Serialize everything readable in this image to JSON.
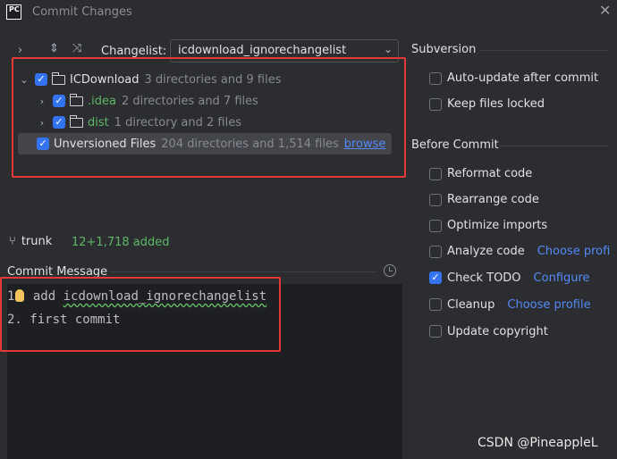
{
  "window": {
    "app_icon_label": "PC",
    "title": "Commit Changes",
    "close_icon": "close-icon"
  },
  "toolbar": {
    "changelist_label": "Changelist:",
    "changelist_value": "icdownload_ignorechangelist"
  },
  "tree": [
    {
      "name": "ICDownload",
      "info": "3 directories and 9 files",
      "checked": true,
      "expanded": true
    },
    {
      "name": ".idea",
      "info": "2 directories and 7 files",
      "checked": true,
      "expanded": false
    },
    {
      "name": "dist",
      "info": "1 directory and 2 files",
      "checked": true,
      "expanded": false
    },
    {
      "name": "Unversioned Files",
      "info": "204 directories and 1,514 files",
      "link": "browse",
      "checked": true
    }
  ],
  "branch": {
    "name": "trunk",
    "stats": "12+1,718 added"
  },
  "commit_message": {
    "label": "Commit Message",
    "lines": [
      {
        "num": "1.",
        "text": "add icdownload_ignorechangelist"
      },
      {
        "num": "2.",
        "text": "first commit"
      }
    ]
  },
  "subversion": {
    "title": "Subversion",
    "options": [
      {
        "label": "Auto-update after commit",
        "checked": false
      },
      {
        "label": "Keep files locked",
        "checked": false
      }
    ]
  },
  "before_commit": {
    "title": "Before Commit",
    "options": [
      {
        "label": "Reformat code",
        "checked": false
      },
      {
        "label": "Rearrange code",
        "checked": false
      },
      {
        "label": "Optimize imports",
        "checked": false
      },
      {
        "label": "Analyze code",
        "checked": false,
        "link": "Choose profi"
      },
      {
        "label": "Check TODO",
        "checked": true,
        "link": "Configure"
      },
      {
        "label": "Cleanup",
        "checked": false,
        "link": "Choose profile"
      },
      {
        "label": "Update copyright",
        "checked": false
      }
    ]
  },
  "watermark": "CSDN @PineappleL",
  "colors": {
    "accent": "#3574f0",
    "link": "#548af7",
    "added_green": "#5fb865",
    "highlight_red": "#e53935"
  }
}
